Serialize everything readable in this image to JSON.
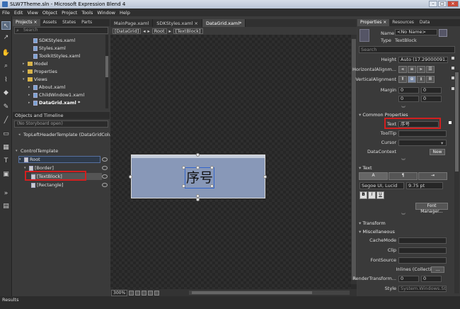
{
  "window": {
    "title": "SLW7Theme.sln - Microsoft Expression Blend 4",
    "minimize": "–",
    "maximize": "□",
    "close": "✕"
  },
  "menu": [
    "File",
    "Edit",
    "View",
    "Object",
    "Project",
    "Tools",
    "Window",
    "Help"
  ],
  "projects_panel": {
    "tabs": [
      "Projects ×",
      "Assets",
      "States",
      "Parts"
    ],
    "search_placeholder": "Search",
    "items": [
      {
        "label": "SDKStyles.xaml",
        "type": "file"
      },
      {
        "label": "Styles.xaml",
        "type": "file"
      },
      {
        "label": "ToolkitStyles.xaml",
        "type": "file"
      },
      {
        "label": "Model",
        "type": "folder"
      },
      {
        "label": "Properties",
        "type": "folder"
      },
      {
        "label": "Views",
        "type": "folder"
      },
      {
        "label": "About.xaml",
        "type": "file"
      },
      {
        "label": "ChildWindow1.xaml",
        "type": "file"
      },
      {
        "label": "DataGrid.xaml *",
        "type": "file"
      }
    ]
  },
  "objects_panel": {
    "title": "Objects and Timeline",
    "storyboard": "(No Storyboard open)",
    "header_item": "TopLeftHeaderTemplate (DataGridColumnHea...",
    "items": [
      {
        "label": "ControlTemplate"
      },
      {
        "label": "Root"
      },
      {
        "label": "[Border]"
      },
      {
        "label": "[TextBlock]"
      },
      {
        "label": "[Rectangle]"
      }
    ]
  },
  "document": {
    "tabs": [
      "MainPage.xaml",
      "SDKStyles.xaml ×",
      "DataGrid.xaml*"
    ],
    "breadcrumb": [
      "[DataGrid]",
      "Root",
      "[TextBlock]"
    ],
    "canvas_text": "序号",
    "zoom": "300%"
  },
  "properties": {
    "tabs": [
      "Properties ×",
      "Resources",
      "Data"
    ],
    "name_label": "Name",
    "name_value": "<No Name>",
    "type_label": "Type",
    "type_value": "TextBlock",
    "search_placeholder": "Search",
    "layout": {
      "height_label": "Height",
      "height_value": "Auto (17.29000091...",
      "halign_label": "HorizontalAlignm...",
      "valign_label": "VerticalAlignment",
      "margin_label": "Margin",
      "margin_values": [
        "0",
        "0",
        "0",
        "0"
      ]
    },
    "common": {
      "title": "Common Properties",
      "text_label": "Text",
      "text_value": "序号",
      "tooltip_label": "ToolTip",
      "cursor_label": "Cursor",
      "datacontext_label": "DataContext",
      "new_button": "New"
    },
    "text_section": {
      "title": "Text",
      "font_family": "Segoe UI, Lucid",
      "font_size": "9.75 pt",
      "bold": "B",
      "italic": "I",
      "underline": "U",
      "font_manager": "Font Manager..."
    },
    "transform_title": "Transform",
    "misc": {
      "title": "Miscellaneous",
      "cachemode_label": "CacheMode",
      "clip_label": "Clip",
      "fontsource_label": "FontSource",
      "inlines_label": "Inlines (Collection)",
      "inlines_button": "...",
      "rendertransform_label": "RenderTransform...",
      "rendertransform_values": [
        "0",
        "0"
      ],
      "style_label": "Style",
      "style_value": "System.Windows.Style"
    }
  },
  "status": {
    "results": "Results"
  },
  "colors": {
    "highlight": "#d21f1f",
    "element_fill": "#8898b8"
  }
}
